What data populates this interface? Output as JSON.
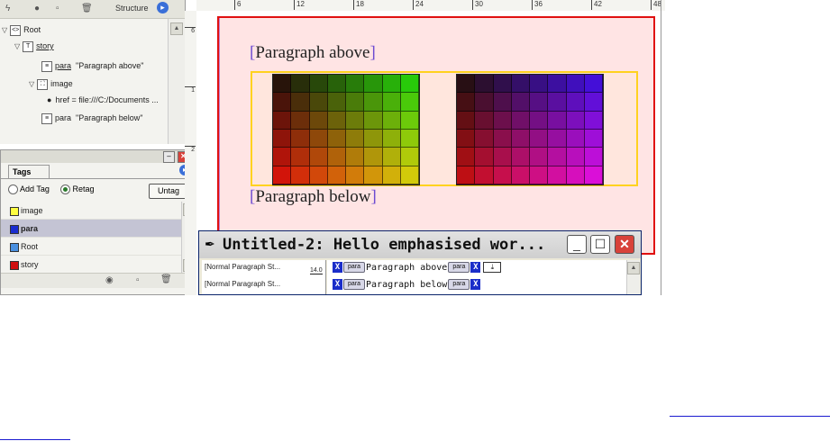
{
  "structure_panel": {
    "header_label": "Structure",
    "items": [
      {
        "label": "Root"
      },
      {
        "label": "story"
      },
      {
        "tag": "para",
        "text": "\"Paragraph above\""
      },
      {
        "label": "image"
      },
      {
        "attr": "href = file:///C:/Documents ..."
      },
      {
        "tag": "para",
        "text": "\"Paragraph below\""
      }
    ]
  },
  "tags_panel": {
    "tab_label": "Tags",
    "add_tag_label": "Add Tag",
    "retag_label": "Retag",
    "untag_label": "Untag",
    "tags": [
      {
        "name": "image",
        "color": "#ffff40"
      },
      {
        "name": "para",
        "color": "#1a2dd0"
      },
      {
        "name": "Root",
        "color": "#4a90e0"
      },
      {
        "name": "story",
        "color": "#d01010"
      }
    ]
  },
  "ruler": {
    "labels": [
      "6",
      "12",
      "18",
      "24",
      "30",
      "36",
      "42",
      "48"
    ],
    "v_labels": [
      "6",
      "1",
      "2"
    ]
  },
  "document": {
    "para_above": "Paragraph above",
    "para_below": "Paragraph below"
  },
  "story_editor": {
    "title": "Untitled-2: Hello emphasised wor...",
    "styles": [
      "[Normal Paragraph St...",
      "[Normal Paragraph St..."
    ],
    "depth": "14.0",
    "rows": [
      {
        "tag": "para",
        "text": "Paragraph above"
      },
      {
        "tag": "para",
        "text": "Paragraph below"
      }
    ]
  },
  "colors": {
    "frame_border": "#e01010",
    "image_frame": "#ffd21f",
    "page_fill": "#ffe4e4",
    "link": "#1a1ad0"
  }
}
